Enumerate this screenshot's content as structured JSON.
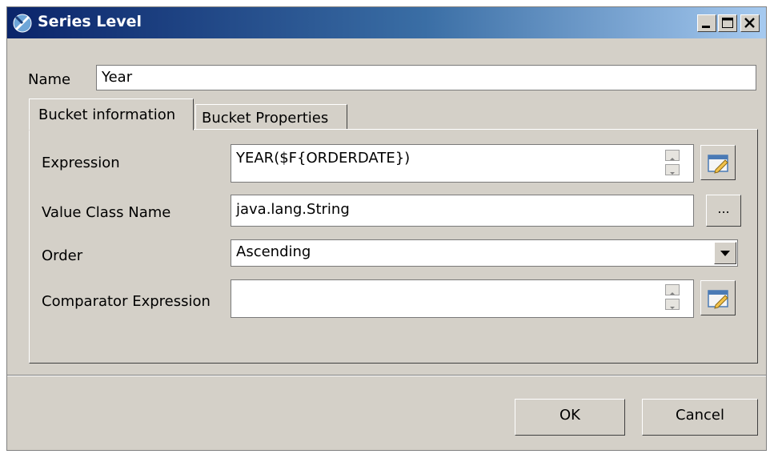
{
  "window": {
    "title": "Series Level"
  },
  "title_buttons": {
    "minimize": "minimize",
    "maximize": "maximize",
    "close": "close"
  },
  "name": {
    "label": "Name",
    "value": "Year"
  },
  "tabs": [
    {
      "label": "Bucket information",
      "selected": true
    },
    {
      "label": "Bucket Properties",
      "selected": false
    }
  ],
  "fields": {
    "expression": {
      "label": "Expression",
      "value": "YEAR($F{ORDERDATE})"
    },
    "value_class": {
      "label": "Value Class Name",
      "value": "java.lang.String",
      "browse": "..."
    },
    "order": {
      "label": "Order",
      "value": "Ascending"
    },
    "comparator": {
      "label": "Comparator Expression",
      "value": ""
    }
  },
  "buttons": {
    "ok": "OK",
    "cancel": "Cancel"
  },
  "icons": {
    "app": "chart-icon",
    "edit": "pencil-icon"
  }
}
